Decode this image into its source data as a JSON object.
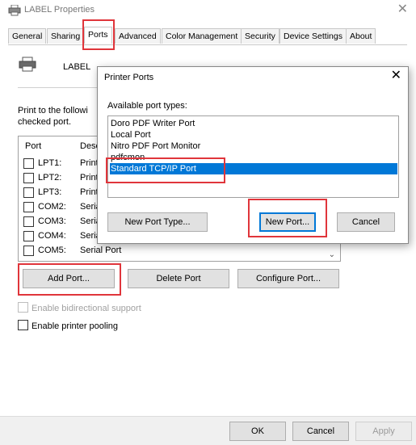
{
  "window": {
    "title": "LABEL Properties",
    "close_glyph": "✕"
  },
  "tabs": [
    {
      "label": "General"
    },
    {
      "label": "Sharing"
    },
    {
      "label": "Ports"
    },
    {
      "label": "Advanced"
    },
    {
      "label": "Color Management"
    },
    {
      "label": "Security"
    },
    {
      "label": "Device Settings"
    },
    {
      "label": "About"
    }
  ],
  "panel": {
    "printer_name": "LABEL",
    "description": "Print to the followi checked port."
  },
  "port_list": {
    "col_port": "Port",
    "col_desc": "Desc",
    "rows": [
      {
        "port": "LPT1:",
        "desc": "Print"
      },
      {
        "port": "LPT2:",
        "desc": "Print"
      },
      {
        "port": "LPT3:",
        "desc": "Print"
      },
      {
        "port": "COM2:",
        "desc": "Seria"
      },
      {
        "port": "COM3:",
        "desc": "Seria"
      },
      {
        "port": "COM4:",
        "desc": "Seria"
      },
      {
        "port": "COM5:",
        "desc": "Serial Port"
      }
    ]
  },
  "buttons": {
    "add_port": "Add Port...",
    "delete_port": "Delete Port",
    "configure_port": "Configure Port...",
    "ok": "OK",
    "cancel": "Cancel",
    "apply": "Apply"
  },
  "options": {
    "bidirectional": "Enable bidirectional support",
    "pooling": "Enable printer pooling"
  },
  "dialog": {
    "title": "Printer Ports",
    "close_glyph": "✕",
    "available_label": "Available port types:",
    "port_types": [
      "Doro PDF Writer Port",
      "Local Port",
      "Nitro PDF Port Monitor",
      "pdfcmon",
      "Standard TCP/IP Port"
    ],
    "selected_index": 4,
    "new_port_type": "New Port Type...",
    "new_port": "New Port...",
    "cancel": "Cancel"
  },
  "colors": {
    "highlight": "#e0353b",
    "selection": "#0078d7"
  }
}
